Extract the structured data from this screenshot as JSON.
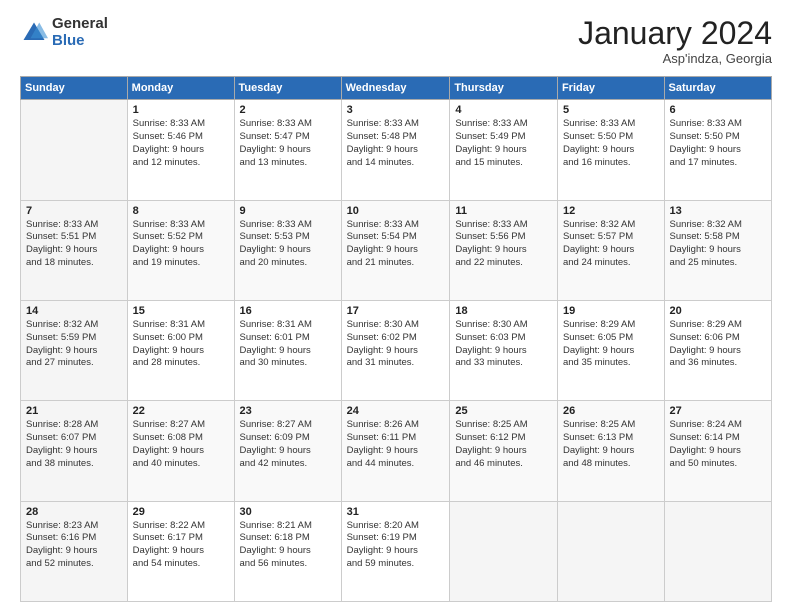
{
  "header": {
    "logo_general": "General",
    "logo_blue": "Blue",
    "month_title": "January 2024",
    "subtitle": "Asp'indza, Georgia"
  },
  "days_header": [
    "Sunday",
    "Monday",
    "Tuesday",
    "Wednesday",
    "Thursday",
    "Friday",
    "Saturday"
  ],
  "weeks": [
    [
      {
        "num": "",
        "lines": []
      },
      {
        "num": "1",
        "lines": [
          "Sunrise: 8:33 AM",
          "Sunset: 5:46 PM",
          "Daylight: 9 hours",
          "and 12 minutes."
        ]
      },
      {
        "num": "2",
        "lines": [
          "Sunrise: 8:33 AM",
          "Sunset: 5:47 PM",
          "Daylight: 9 hours",
          "and 13 minutes."
        ]
      },
      {
        "num": "3",
        "lines": [
          "Sunrise: 8:33 AM",
          "Sunset: 5:48 PM",
          "Daylight: 9 hours",
          "and 14 minutes."
        ]
      },
      {
        "num": "4",
        "lines": [
          "Sunrise: 8:33 AM",
          "Sunset: 5:49 PM",
          "Daylight: 9 hours",
          "and 15 minutes."
        ]
      },
      {
        "num": "5",
        "lines": [
          "Sunrise: 8:33 AM",
          "Sunset: 5:50 PM",
          "Daylight: 9 hours",
          "and 16 minutes."
        ]
      },
      {
        "num": "6",
        "lines": [
          "Sunrise: 8:33 AM",
          "Sunset: 5:50 PM",
          "Daylight: 9 hours",
          "and 17 minutes."
        ]
      }
    ],
    [
      {
        "num": "7",
        "lines": [
          "Sunrise: 8:33 AM",
          "Sunset: 5:51 PM",
          "Daylight: 9 hours",
          "and 18 minutes."
        ]
      },
      {
        "num": "8",
        "lines": [
          "Sunrise: 8:33 AM",
          "Sunset: 5:52 PM",
          "Daylight: 9 hours",
          "and 19 minutes."
        ]
      },
      {
        "num": "9",
        "lines": [
          "Sunrise: 8:33 AM",
          "Sunset: 5:53 PM",
          "Daylight: 9 hours",
          "and 20 minutes."
        ]
      },
      {
        "num": "10",
        "lines": [
          "Sunrise: 8:33 AM",
          "Sunset: 5:54 PM",
          "Daylight: 9 hours",
          "and 21 minutes."
        ]
      },
      {
        "num": "11",
        "lines": [
          "Sunrise: 8:33 AM",
          "Sunset: 5:56 PM",
          "Daylight: 9 hours",
          "and 22 minutes."
        ]
      },
      {
        "num": "12",
        "lines": [
          "Sunrise: 8:32 AM",
          "Sunset: 5:57 PM",
          "Daylight: 9 hours",
          "and 24 minutes."
        ]
      },
      {
        "num": "13",
        "lines": [
          "Sunrise: 8:32 AM",
          "Sunset: 5:58 PM",
          "Daylight: 9 hours",
          "and 25 minutes."
        ]
      }
    ],
    [
      {
        "num": "14",
        "lines": [
          "Sunrise: 8:32 AM",
          "Sunset: 5:59 PM",
          "Daylight: 9 hours",
          "and 27 minutes."
        ]
      },
      {
        "num": "15",
        "lines": [
          "Sunrise: 8:31 AM",
          "Sunset: 6:00 PM",
          "Daylight: 9 hours",
          "and 28 minutes."
        ]
      },
      {
        "num": "16",
        "lines": [
          "Sunrise: 8:31 AM",
          "Sunset: 6:01 PM",
          "Daylight: 9 hours",
          "and 30 minutes."
        ]
      },
      {
        "num": "17",
        "lines": [
          "Sunrise: 8:30 AM",
          "Sunset: 6:02 PM",
          "Daylight: 9 hours",
          "and 31 minutes."
        ]
      },
      {
        "num": "18",
        "lines": [
          "Sunrise: 8:30 AM",
          "Sunset: 6:03 PM",
          "Daylight: 9 hours",
          "and 33 minutes."
        ]
      },
      {
        "num": "19",
        "lines": [
          "Sunrise: 8:29 AM",
          "Sunset: 6:05 PM",
          "Daylight: 9 hours",
          "and 35 minutes."
        ]
      },
      {
        "num": "20",
        "lines": [
          "Sunrise: 8:29 AM",
          "Sunset: 6:06 PM",
          "Daylight: 9 hours",
          "and 36 minutes."
        ]
      }
    ],
    [
      {
        "num": "21",
        "lines": [
          "Sunrise: 8:28 AM",
          "Sunset: 6:07 PM",
          "Daylight: 9 hours",
          "and 38 minutes."
        ]
      },
      {
        "num": "22",
        "lines": [
          "Sunrise: 8:27 AM",
          "Sunset: 6:08 PM",
          "Daylight: 9 hours",
          "and 40 minutes."
        ]
      },
      {
        "num": "23",
        "lines": [
          "Sunrise: 8:27 AM",
          "Sunset: 6:09 PM",
          "Daylight: 9 hours",
          "and 42 minutes."
        ]
      },
      {
        "num": "24",
        "lines": [
          "Sunrise: 8:26 AM",
          "Sunset: 6:11 PM",
          "Daylight: 9 hours",
          "and 44 minutes."
        ]
      },
      {
        "num": "25",
        "lines": [
          "Sunrise: 8:25 AM",
          "Sunset: 6:12 PM",
          "Daylight: 9 hours",
          "and 46 minutes."
        ]
      },
      {
        "num": "26",
        "lines": [
          "Sunrise: 8:25 AM",
          "Sunset: 6:13 PM",
          "Daylight: 9 hours",
          "and 48 minutes."
        ]
      },
      {
        "num": "27",
        "lines": [
          "Sunrise: 8:24 AM",
          "Sunset: 6:14 PM",
          "Daylight: 9 hours",
          "and 50 minutes."
        ]
      }
    ],
    [
      {
        "num": "28",
        "lines": [
          "Sunrise: 8:23 AM",
          "Sunset: 6:16 PM",
          "Daylight: 9 hours",
          "and 52 minutes."
        ]
      },
      {
        "num": "29",
        "lines": [
          "Sunrise: 8:22 AM",
          "Sunset: 6:17 PM",
          "Daylight: 9 hours",
          "and 54 minutes."
        ]
      },
      {
        "num": "30",
        "lines": [
          "Sunrise: 8:21 AM",
          "Sunset: 6:18 PM",
          "Daylight: 9 hours",
          "and 56 minutes."
        ]
      },
      {
        "num": "31",
        "lines": [
          "Sunrise: 8:20 AM",
          "Sunset: 6:19 PM",
          "Daylight: 9 hours",
          "and 59 minutes."
        ]
      },
      {
        "num": "",
        "lines": []
      },
      {
        "num": "",
        "lines": []
      },
      {
        "num": "",
        "lines": []
      }
    ]
  ]
}
